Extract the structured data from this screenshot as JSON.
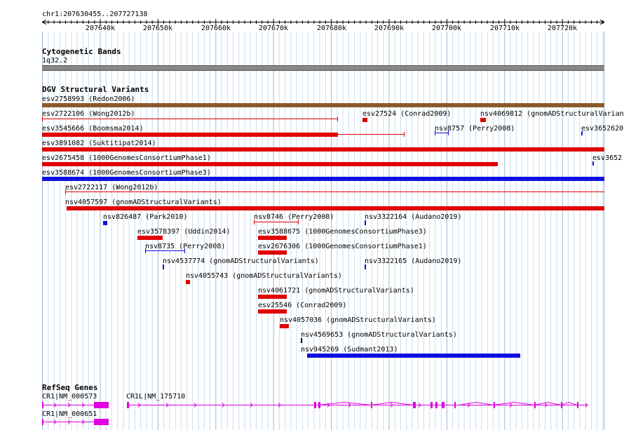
{
  "ruler": {
    "location": "chr1:207630455..207727138",
    "ticks": [
      "207640k",
      "207650k",
      "207660k",
      "207670k",
      "207680k",
      "207690k",
      "207700k",
      "207710k",
      "207720k"
    ]
  },
  "tracks": {
    "cytoband": {
      "title": "Cytogenetic Bands",
      "band": "1q32.2"
    },
    "dgv": {
      "title": "DGV Structural Variants",
      "features": [
        {
          "label": "esv2758993 (Redon2006)",
          "color": "#8b5a2b"
        },
        {
          "label": "esv2722106 (Wong2012b)",
          "color": "#e00000"
        },
        {
          "label": "esv27524 (Conrad2009)",
          "color": "#e00000"
        },
        {
          "label": "nsv4069812 (gnomADStructuralVariants)",
          "color": "#e00000"
        },
        {
          "label": "esv3545666 (Boomsma2014)",
          "color": "#e00000"
        },
        {
          "label": "nsv8757 (Perry2008)",
          "color": "#1010e0"
        },
        {
          "label": "esv3652620",
          "color": "#1010e0"
        },
        {
          "label": "esv3891082 (Suktitipat2014)",
          "color": "#e00000"
        },
        {
          "label": "esv2675458 (1000GenomesConsortiumPhase1)",
          "color": "#e00000"
        },
        {
          "label": "esv3652",
          "color": "#1010e0"
        },
        {
          "label": "esv3588674 (1000GenomesConsortiumPhase3)",
          "color": "#1010e0"
        },
        {
          "label": "esv2722117 (Wong2012b)",
          "color": "#e00000"
        },
        {
          "label": "nsv4057597 (gnomADStructuralVariants)",
          "color": "#e00000"
        },
        {
          "label": "nsv826487 (Park2010)",
          "color": "#1010e0"
        },
        {
          "label": "nsv8746 (Perry2008)",
          "color": "#e00000"
        },
        {
          "label": "nsv3322164 (Audano2019)",
          "color": "#1010e0"
        },
        {
          "label": "esv3578397 (Uddin2014)",
          "color": "#e00000"
        },
        {
          "label": "esv3588675 (1000GenomesConsortiumPhase3)",
          "color": "#e00000"
        },
        {
          "label": "nsv8735 (Perry2008)",
          "color": "#1010e0"
        },
        {
          "label": "esv2676306 (1000GenomesConsortiumPhase1)",
          "color": "#e00000"
        },
        {
          "label": "nsv4537774 (gnomADStructuralVariants)",
          "color": "#1010e0"
        },
        {
          "label": "nsv3322165 (Audano2019)",
          "color": "#1010e0"
        },
        {
          "label": "nsv4055743 (gnomADStructuralVariants)",
          "color": "#e00000"
        },
        {
          "label": "nsv4061721 (gnomADStructuralVariants)",
          "color": "#e00000"
        },
        {
          "label": "esv25546 (Conrad2009)",
          "color": "#e00000"
        },
        {
          "label": "nsv4057036 (gnomADStructuralVariants)",
          "color": "#e00000"
        },
        {
          "label": "nsv4569653 (gnomADStructuralVariants)",
          "color": "#000000"
        },
        {
          "label": "nsv945269 (Sudmant2013)",
          "color": "#1010e0"
        }
      ]
    },
    "refseq": {
      "title": "RefSeq Genes",
      "genes": [
        {
          "label": "CR1|NM_000573",
          "color": "#e000e0"
        },
        {
          "label": "CR1L|NM_175710",
          "color": "#e000e0"
        },
        {
          "label": "CR1|NM_000651",
          "color": "#e000e0"
        }
      ]
    }
  }
}
